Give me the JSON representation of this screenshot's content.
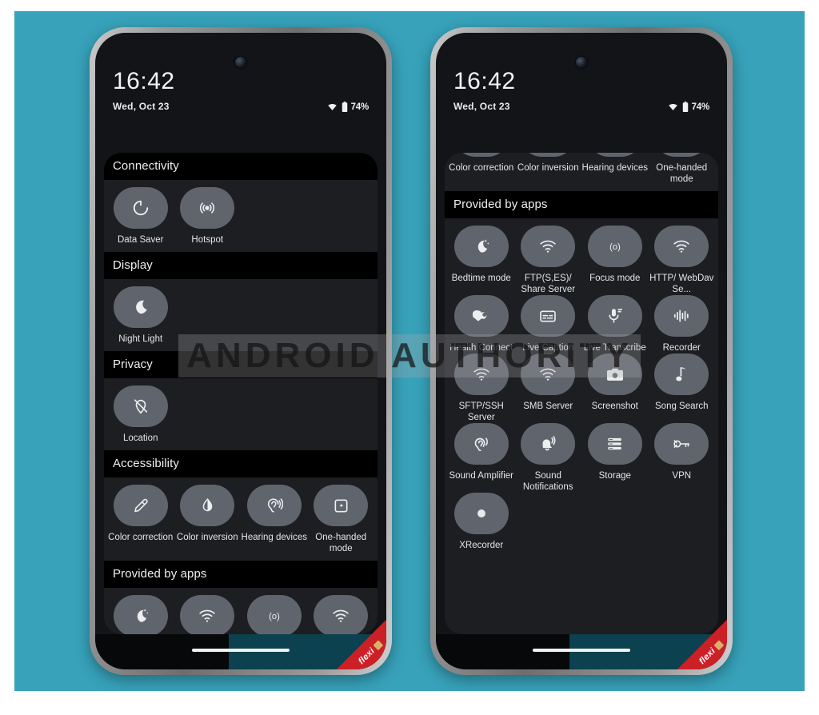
{
  "background": {
    "color": "#37a2ba"
  },
  "watermark": {
    "text": "ANDROID AUTHORITY"
  },
  "ribbon": {
    "label": "flexi"
  },
  "status": {
    "time": "16:42",
    "date": "Wed, Oct 23",
    "battery": "74%",
    "wifi_icon": "wifi-icon",
    "battery_icon": "battery-icon"
  },
  "phone1": {
    "sections": [
      {
        "title": "Connectivity",
        "tiles": [
          {
            "label": "Data Saver",
            "icon": "data-saver-icon"
          },
          {
            "label": "Hotspot",
            "icon": "hotspot-icon"
          }
        ]
      },
      {
        "title": "Display",
        "tiles": [
          {
            "label": "Night Light",
            "icon": "moon-icon"
          }
        ]
      },
      {
        "title": "Privacy",
        "tiles": [
          {
            "label": "Location",
            "icon": "location-off-icon"
          }
        ]
      },
      {
        "title": "Accessibility",
        "tiles": [
          {
            "label": "Color correction",
            "icon": "eyedropper-icon"
          },
          {
            "label": "Color inversion",
            "icon": "contrast-icon"
          },
          {
            "label": "Hearing devices",
            "icon": "hearing-icon"
          },
          {
            "label": "One-handed mode",
            "icon": "one-handed-icon"
          }
        ]
      },
      {
        "title": "Provided by apps",
        "tiles": [
          {
            "label": "",
            "icon": "bedtime-icon"
          },
          {
            "label": "",
            "icon": "wifi-icon"
          },
          {
            "label": "",
            "icon": "focus-icon"
          },
          {
            "label": "",
            "icon": "wifi-icon"
          }
        ]
      }
    ]
  },
  "phone2": {
    "sections": [
      {
        "title": "",
        "tiles": [
          {
            "label": "Color correction",
            "icon": "eyedropper-icon"
          },
          {
            "label": "Color inversion",
            "icon": "contrast-icon"
          },
          {
            "label": "Hearing devices",
            "icon": "hearing-icon"
          },
          {
            "label": "One-handed mode",
            "icon": "one-handed-icon"
          }
        ]
      },
      {
        "title": "Provided by apps",
        "tiles": [
          {
            "label": "Bedtime mode",
            "icon": "bedtime-icon"
          },
          {
            "label": "FTP(S,ES)/ Share Server",
            "icon": "wifi-icon"
          },
          {
            "label": "Focus mode",
            "icon": "focus-icon"
          },
          {
            "label": "HTTP/ WebDav Se...",
            "icon": "wifi-icon"
          },
          {
            "label": "Health Connect",
            "icon": "health-connect-icon"
          },
          {
            "label": "Live Caption",
            "icon": "live-caption-icon"
          },
          {
            "label": "Live Transcribe",
            "icon": "transcribe-icon"
          },
          {
            "label": "Recorder",
            "icon": "waveform-icon"
          },
          {
            "label": "SFTP/SSH Server",
            "icon": "wifi-icon"
          },
          {
            "label": "SMB Server",
            "icon": "wifi-icon"
          },
          {
            "label": "Screenshot",
            "icon": "camera-icon"
          },
          {
            "label": "Song Search",
            "icon": "music-note-icon"
          },
          {
            "label": "Sound Amplifier",
            "icon": "sound-amplifier-icon"
          },
          {
            "label": "Sound Notifications",
            "icon": "bell-alert-icon"
          },
          {
            "label": "Storage",
            "icon": "storage-icon"
          },
          {
            "label": "VPN",
            "icon": "vpn-key-icon"
          },
          {
            "label": "XRecorder",
            "icon": "record-dot-icon"
          }
        ]
      }
    ]
  }
}
